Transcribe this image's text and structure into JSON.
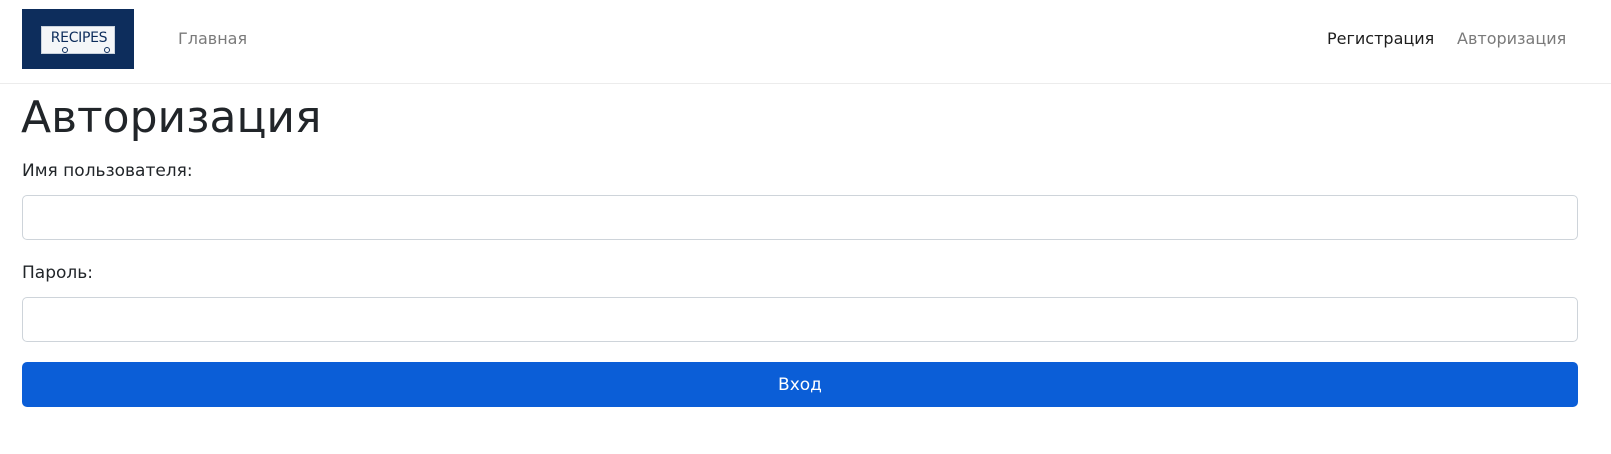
{
  "navbar": {
    "logo_text": "RECIPES",
    "home_label": "Главная",
    "register_label": "Регистрация",
    "login_label": "Авторизация"
  },
  "page": {
    "title": "Авторизация"
  },
  "form": {
    "username_label": "Имя пользователя:",
    "username_value": "",
    "password_label": "Пароль:",
    "password_value": "",
    "submit_label": "Вход"
  },
  "colors": {
    "logo_bg": "#0d2d5c",
    "primary": "#0b5ed7",
    "nav_active": "#1d1d1d",
    "nav_muted": "#7a7a7a"
  }
}
